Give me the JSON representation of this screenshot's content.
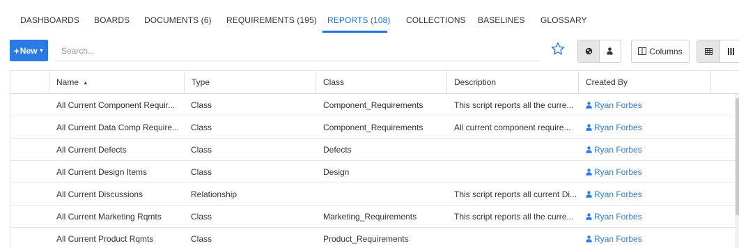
{
  "tabs": [
    {
      "label": "DASHBOARDS",
      "active": false
    },
    {
      "label": "BOARDS",
      "active": false
    },
    {
      "label": "DOCUMENTS (6)",
      "active": false
    },
    {
      "label": "REQUIREMENTS (195)",
      "active": false
    },
    {
      "label": "REPORTS (108)",
      "active": true
    },
    {
      "label": "COLLECTIONS",
      "active": false
    },
    {
      "label": "BASELINES",
      "active": false
    },
    {
      "label": "GLOSSARY",
      "active": false
    }
  ],
  "toolbar": {
    "new_label": "New",
    "search_placeholder": "Search...",
    "columns_label": "Columns",
    "icons": [
      "star-icon",
      "globe-icon",
      "user-icon",
      "columns-icon",
      "grid-view-icon",
      "list-view-icon"
    ]
  },
  "table": {
    "columns": [
      "Name",
      "Type",
      "Class",
      "Description",
      "Created By"
    ],
    "sort": {
      "column": "Name",
      "direction": "ascending"
    },
    "rows": [
      {
        "name": "All Current Component Requir...",
        "type": "Class",
        "class": "Component_Requirements",
        "description": "This script reports all the curre...",
        "created_by": "Ryan Forbes"
      },
      {
        "name": "All Current Data Comp Require...",
        "type": "Class",
        "class": "Component_Requirements",
        "description": "All current component require...",
        "created_by": "Ryan Forbes"
      },
      {
        "name": "All Current Defects",
        "type": "Class",
        "class": "Defects",
        "description": "",
        "created_by": "Ryan Forbes"
      },
      {
        "name": "All Current Design Items",
        "type": "Class",
        "class": "Design",
        "description": "",
        "created_by": "Ryan Forbes"
      },
      {
        "name": "All Current Discussions",
        "type": "Relationship",
        "class": "",
        "description": "This script reports all current Di...",
        "created_by": "Ryan Forbes"
      },
      {
        "name": "All Current Marketing Rqmts",
        "type": "Class",
        "class": "Marketing_Requirements",
        "description": "This script reports all the curre...",
        "created_by": "Ryan Forbes"
      },
      {
        "name": "All Current Product Rqmts",
        "type": "Class",
        "class": "Product_Requirements",
        "description": "",
        "created_by": "Ryan Forbes"
      }
    ]
  },
  "colors": {
    "accent": "#2a7be4",
    "tab_active": "#1a73e8"
  }
}
